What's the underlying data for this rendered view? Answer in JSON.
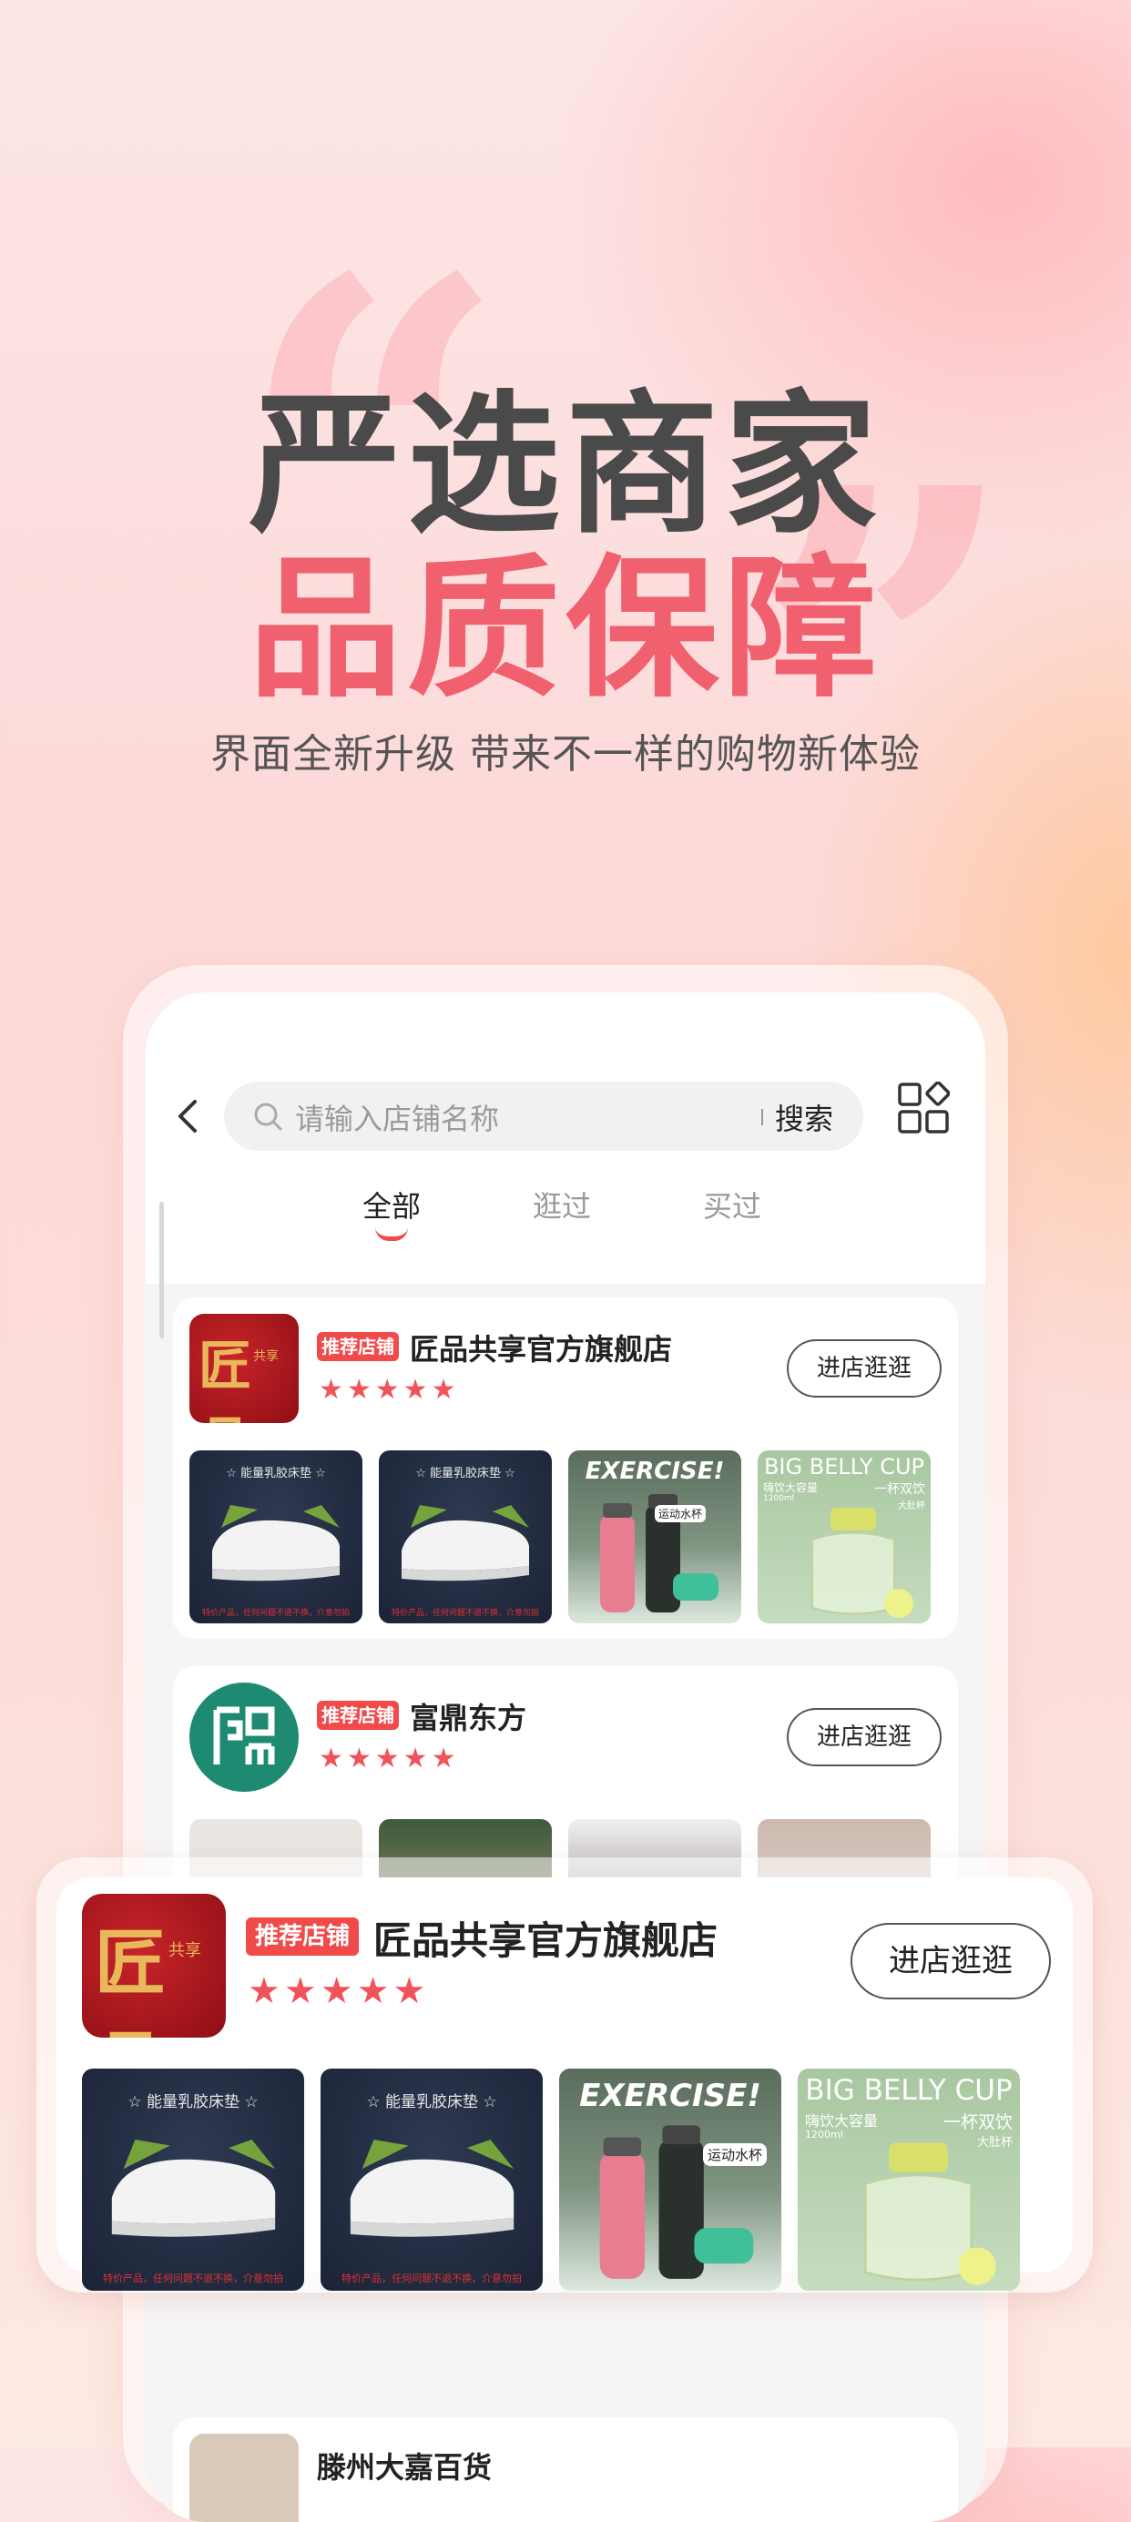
{
  "hero": {
    "title_line1": "严选商家",
    "title_line2": "品质保障",
    "subtitle": "界面全新升级 带来不一样的购物新体验"
  },
  "app": {
    "search": {
      "placeholder": "请输入店铺名称",
      "button": "搜索"
    },
    "tabs": [
      {
        "label": "全部",
        "active": true
      },
      {
        "label": "逛过",
        "active": false
      },
      {
        "label": "买过",
        "active": false
      }
    ],
    "stores": [
      {
        "badge": "推荐店铺",
        "name": "匠品共享官方旗舰店",
        "rating_stars": 5,
        "stars_text": "★★★★★",
        "visit_label": "进店逛逛",
        "logo_text": "匠品",
        "logo_small": "共享",
        "products": [
          {
            "type": "mattress",
            "tag": "☆ 能量乳胶床垫 ☆",
            "footer": "特价产品，任何问题不退不换，介意勿拍"
          },
          {
            "type": "mattress",
            "tag": "☆ 能量乳胶床垫 ☆",
            "footer": "特价产品，任何问题不退不换，介意勿拍"
          },
          {
            "type": "bottles",
            "title": "EXERCISE!",
            "tag": "运动水杯"
          },
          {
            "type": "cup",
            "title": "BIG BELLY CUP",
            "line1": "嗨饮大容量",
            "line2": "一杯双饮",
            "line3": "大肚杯",
            "cap": "1200ml"
          }
        ]
      },
      {
        "badge": "推荐店铺",
        "name": "富鼎东方",
        "rating_stars": 5,
        "stars_text": "★★★★★",
        "visit_label": "进店逛逛"
      },
      {
        "name": "滕州大嘉百货"
      }
    ]
  },
  "colors": {
    "accent": "#f04a4a",
    "title_dark": "#4a4a4a",
    "title_pink": "#f0606e",
    "star": "#f0545a"
  }
}
